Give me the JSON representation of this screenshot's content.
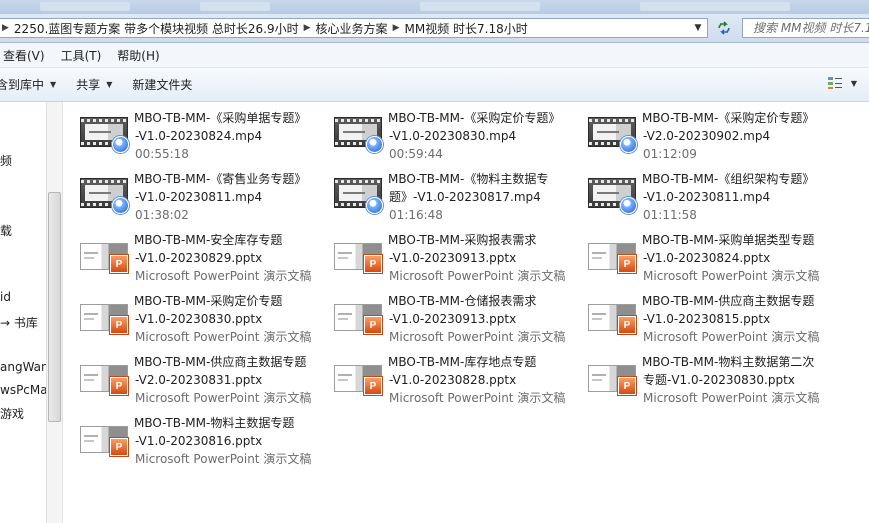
{
  "address": {
    "crumbs": [
      "2250.蓝图专题方案 带多个模块视频 总时长26.9小时",
      "核心业务方案",
      "MM视频 时长7.18小时"
    ],
    "search_placeholder": "搜索 MM视频 时长7.18小时"
  },
  "menu": [
    "查看(V)",
    "工具(T)",
    "帮助(H)"
  ],
  "commands": {
    "include_library": "含到库中",
    "share": "共享",
    "new_folder": "新建文件夹"
  },
  "nav": [
    "频",
    "载",
    "id",
    "→ 书库",
    "angWan",
    "wsPcMa",
    "游戏"
  ],
  "colors": {
    "window_blue": "#cfdcee",
    "meta_gray": "#6d6d6d",
    "ppt_orange": "#d64a12"
  },
  "files": [
    {
      "line1": "MBO-TB-MM-《采购单据专题》",
      "line2": "-V1.0-20230824.mp4",
      "line3": "00:55:18",
      "kind": "video"
    },
    {
      "line1": "MBO-TB-MM-《采购定价专题》",
      "line2": "-V1.0-20230830.mp4",
      "line3": "00:59:44",
      "kind": "video"
    },
    {
      "line1": "MBO-TB-MM-《采购定价专题》",
      "line2": "-V2.0-20230902.mp4",
      "line3": "01:12:09",
      "kind": "video"
    },
    {
      "line1": "MBO-TB-MM-《寄售业务专题》",
      "line2": "-V1.0-20230811.mp4",
      "line3": "01:38:02",
      "kind": "video"
    },
    {
      "line1": "MBO-TB-MM-《物料主数据专",
      "line2": "题》-V1.0-20230817.mp4",
      "line3": "01:16:48",
      "kind": "video"
    },
    {
      "line1": "MBO-TB-MM-《组织架构专题》",
      "line2": "-V1.0-20230811.mp4",
      "line3": "01:11:58",
      "kind": "video"
    },
    {
      "line1": "MBO-TB-MM-安全库存专题",
      "line2": "-V1.0-20230829.pptx",
      "line3": "Microsoft PowerPoint 演示文稿",
      "kind": "ppt"
    },
    {
      "line1": "MBO-TB-MM-采购报表需求",
      "line2": "-V1.0-20230913.pptx",
      "line3": "Microsoft PowerPoint 演示文稿",
      "kind": "ppt"
    },
    {
      "line1": "MBO-TB-MM-采购单据类型专题",
      "line2": "-V1.0-20230824.pptx",
      "line3": "Microsoft PowerPoint 演示文稿",
      "kind": "ppt"
    },
    {
      "line1": "MBO-TB-MM-采购定价专题",
      "line2": "-V1.0-20230830.pptx",
      "line3": "Microsoft PowerPoint 演示文稿",
      "kind": "ppt"
    },
    {
      "line1": "MBO-TB-MM-仓储报表需求",
      "line2": "-V1.0-20230913.pptx",
      "line3": "Microsoft PowerPoint 演示文稿",
      "kind": "ppt"
    },
    {
      "line1": "MBO-TB-MM-供应商主数据专题",
      "line2": "-V1.0-20230815.pptx",
      "line3": "Microsoft PowerPoint 演示文稿",
      "kind": "ppt"
    },
    {
      "line1": "MBO-TB-MM-供应商主数据专题",
      "line2": "-V2.0-20230831.pptx",
      "line3": "Microsoft PowerPoint 演示文稿",
      "kind": "ppt"
    },
    {
      "line1": "MBO-TB-MM-库存地点专题",
      "line2": "-V1.0-20230828.pptx",
      "line3": "Microsoft PowerPoint 演示文稿",
      "kind": "ppt"
    },
    {
      "line1": "MBO-TB-MM-物料主数据第二次",
      "line2": "专题-V1.0-20230830.pptx",
      "line3": "Microsoft PowerPoint 演示文稿",
      "kind": "ppt"
    },
    {
      "line1": "MBO-TB-MM-物料主数据专题",
      "line2": "-V1.0-20230816.pptx",
      "line3": "Microsoft PowerPoint 演示文稿",
      "kind": "ppt"
    }
  ]
}
